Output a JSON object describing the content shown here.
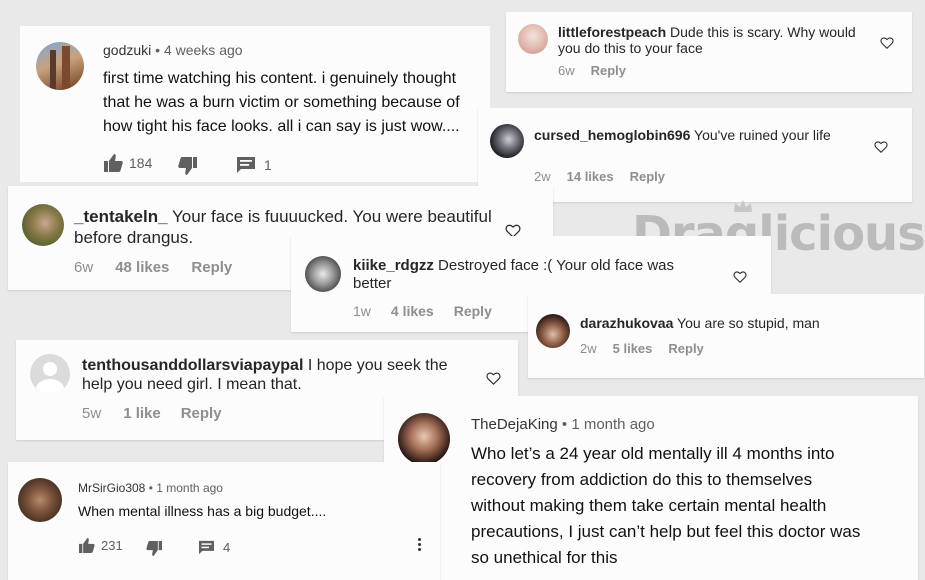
{
  "watermark": "Draglicious",
  "comments": [
    {
      "platform": "youtube",
      "user": "godzuki",
      "time": "4 weeks ago",
      "text": [
        "first time watching his content. i genuinely thought",
        "that he was a burn victim or something because of",
        "how tight his face looks. all i can say is just wow...."
      ],
      "likes": "184",
      "replies": "1"
    },
    {
      "platform": "instagram",
      "user": "littleforestpeach",
      "text": "Dude this is scary. Why would you do this to your face",
      "age": "6w",
      "reply": "Reply"
    },
    {
      "platform": "instagram",
      "user": "cursed_hemoglobin696",
      "text": "You've ruined your life",
      "age": "2w",
      "likes": "14 likes",
      "reply": "Reply"
    },
    {
      "platform": "instagram",
      "user": "_tentakeln_",
      "text": "Your face is fuuuucked. You were beautiful before drangus.",
      "age": "6w",
      "likes": "48 likes",
      "reply": "Reply"
    },
    {
      "platform": "instagram",
      "user": "kiike_rdgzz",
      "text": "Destroyed face :( Your old face was better",
      "age": "1w",
      "likes": "4 likes",
      "reply": "Reply"
    },
    {
      "platform": "instagram",
      "user": "darazhukovaa",
      "text": "You are so stupid, man",
      "age": "2w",
      "likes": "5 likes",
      "reply": "Reply"
    },
    {
      "platform": "instagram",
      "user": "tenthousanddollarsviapaypal",
      "text": "I hope you seek the help you need girl. I mean that.",
      "age": "5w",
      "likes": "1 like",
      "reply": "Reply"
    },
    {
      "platform": "youtube",
      "user": "TheDejaKing",
      "time": "1 month ago",
      "text": [
        "Who let’s a 24 year old mentally ill 4 months into",
        "recovery from addiction do this to themselves",
        "without making them take certain mental health",
        "precautions, I just can’t help but feel this doctor was",
        "so unethical for this"
      ]
    },
    {
      "platform": "youtube",
      "user": "MrSirGio308",
      "time": "1 month ago",
      "text": [
        "When mental illness has a big budget...."
      ],
      "likes": "231",
      "replies": "4"
    }
  ]
}
